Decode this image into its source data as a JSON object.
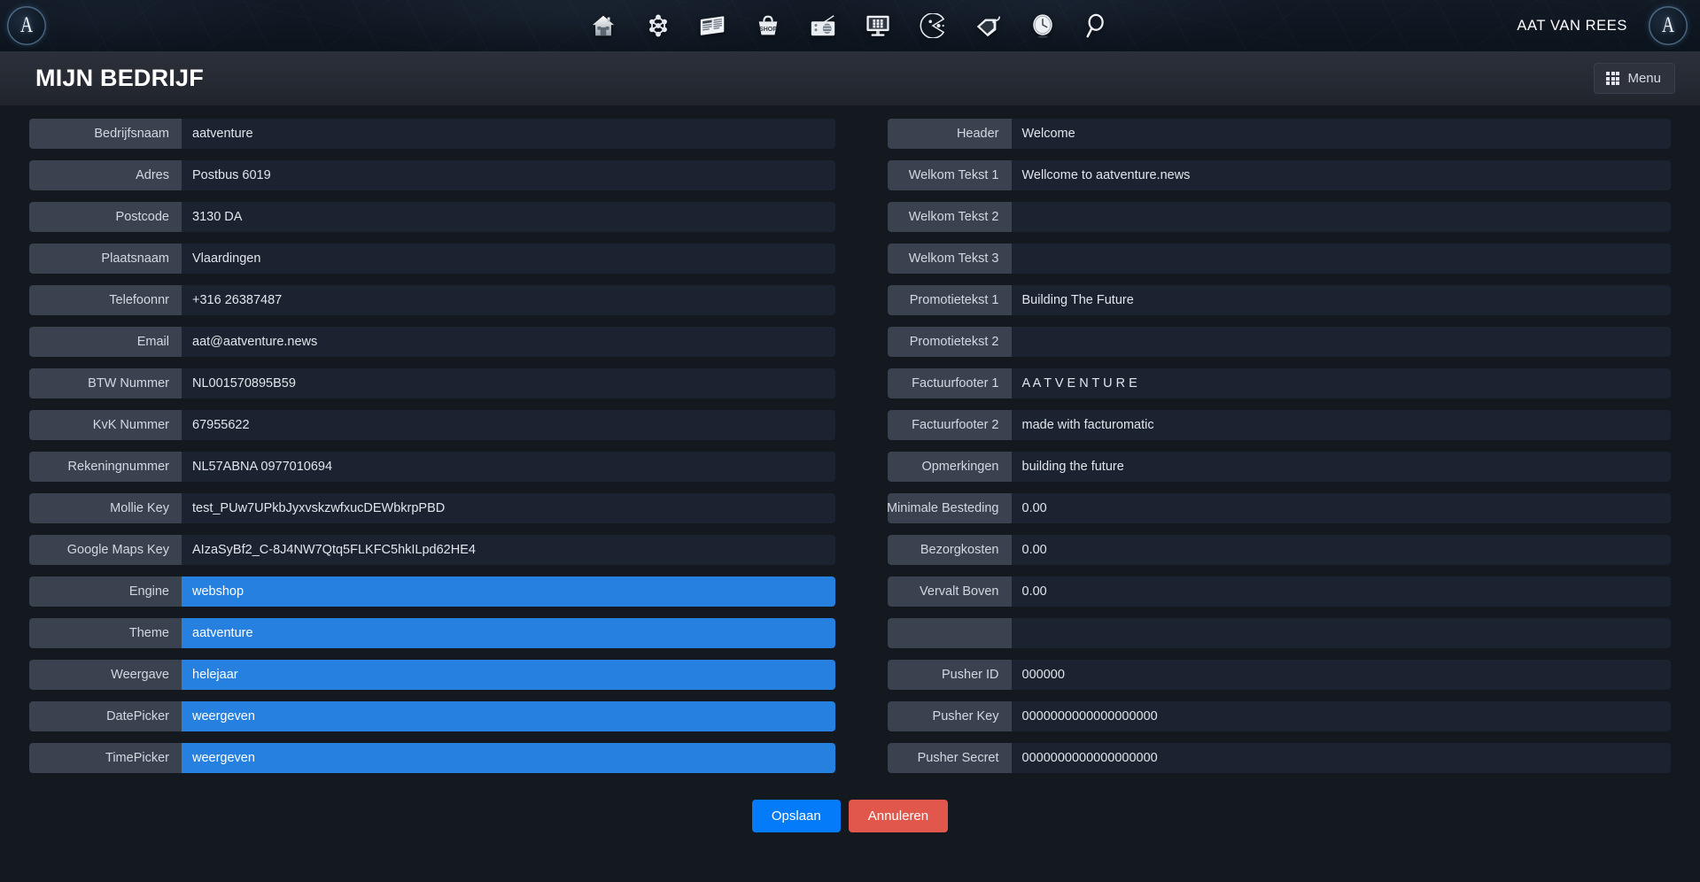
{
  "topbar": {
    "logo_glyph": "A",
    "user_name": "AAT VAN REES",
    "nav_icons": [
      {
        "name": "home-icon",
        "title": "Home"
      },
      {
        "name": "molecule-icon",
        "title": "Instellingen"
      },
      {
        "name": "newspaper-icon",
        "title": "Nieuws"
      },
      {
        "name": "shop-basket-icon",
        "title": "Shop"
      },
      {
        "name": "radio-icon",
        "title": "Radio"
      },
      {
        "name": "monitor-icon",
        "title": "Scherm"
      },
      {
        "name": "pacman-icon",
        "title": "Games"
      },
      {
        "name": "price-tag-icon",
        "title": "Aanbiedingen"
      },
      {
        "name": "clock-icon",
        "title": "Tijd"
      },
      {
        "name": "search-icon",
        "title": "Zoeken"
      }
    ]
  },
  "titlebar": {
    "page_title": "MIJN BEDRIJF",
    "menu_label": "Menu"
  },
  "left_fields": [
    {
      "label": "Bedrijfsnaam",
      "value": "aatventure",
      "selected": false
    },
    {
      "label": "Adres",
      "value": "Postbus 6019",
      "selected": false
    },
    {
      "label": "Postcode",
      "value": "3130 DA",
      "selected": false
    },
    {
      "label": "Plaatsnaam",
      "value": "Vlaardingen",
      "selected": false
    },
    {
      "label": "Telefoonnr",
      "value": "+316 26387487",
      "selected": false
    },
    {
      "label": "Email",
      "value": "aat@aatventure.news",
      "selected": false
    },
    {
      "label": "BTW Nummer",
      "value": "NL001570895B59",
      "selected": false
    },
    {
      "label": "KvK Nummer",
      "value": "67955622",
      "selected": false
    },
    {
      "label": "Rekeningnummer",
      "value": "NL57ABNA 0977010694",
      "selected": false
    },
    {
      "label": "Mollie Key",
      "value": "test_PUw7UPkbJyxvskzwfxucDEWbkrpPBD",
      "selected": false
    },
    {
      "label": "Google Maps Key",
      "value": "AIzaSyBf2_C-8J4NW7Qtq5FLKFC5hkILpd62HE4",
      "selected": false
    },
    {
      "label": "Engine",
      "value": "webshop",
      "selected": true
    },
    {
      "label": "Theme",
      "value": "aatventure",
      "selected": true
    },
    {
      "label": "Weergave",
      "value": "helejaar",
      "selected": true
    },
    {
      "label": "DatePicker",
      "value": "weergeven",
      "selected": true
    },
    {
      "label": "TimePicker",
      "value": "weergeven",
      "selected": true
    }
  ],
  "right_fields": [
    {
      "label": "Header",
      "value": "Welcome",
      "selected": false
    },
    {
      "label": "Welkom Tekst 1",
      "value": "Wellcome to aatventure.news",
      "selected": false
    },
    {
      "label": "Welkom Tekst 2",
      "value": "",
      "selected": false
    },
    {
      "label": "Welkom Tekst 3",
      "value": "",
      "selected": false
    },
    {
      "label": "Promotietekst 1",
      "value": "Building The Future",
      "selected": false
    },
    {
      "label": "Promotietekst 2",
      "value": "",
      "selected": false
    },
    {
      "label": "Factuurfooter 1",
      "value": "A A T V E N T U R E",
      "selected": false
    },
    {
      "label": "Factuurfooter 2",
      "value": "made with facturomatic",
      "selected": false
    },
    {
      "label": "Opmerkingen",
      "value": "building the future",
      "selected": false
    },
    {
      "label": "Minimale Besteding",
      "value": "0.00",
      "selected": false
    },
    {
      "label": "Bezorgkosten",
      "value": "0.00",
      "selected": false
    },
    {
      "label": "Vervalt Boven",
      "value": "0.00",
      "selected": false
    },
    {
      "label": "",
      "value": "",
      "selected": false
    },
    {
      "label": "Pusher ID",
      "value": "000000",
      "selected": false
    },
    {
      "label": "Pusher Key",
      "value": "0000000000000000000",
      "selected": false
    },
    {
      "label": "Pusher Secret",
      "value": "0000000000000000000",
      "selected": false
    }
  ],
  "actions": {
    "save_label": "Opslaan",
    "cancel_label": "Annuleren"
  },
  "colors": {
    "accent_blue": "#047bf8",
    "danger_red": "#e2574c",
    "selected_row": "#2680e0",
    "label_bg": "#3a4250",
    "value_bg": "#1b2230",
    "page_bg": "#14181f",
    "titlebar_bg": "#262b34"
  }
}
